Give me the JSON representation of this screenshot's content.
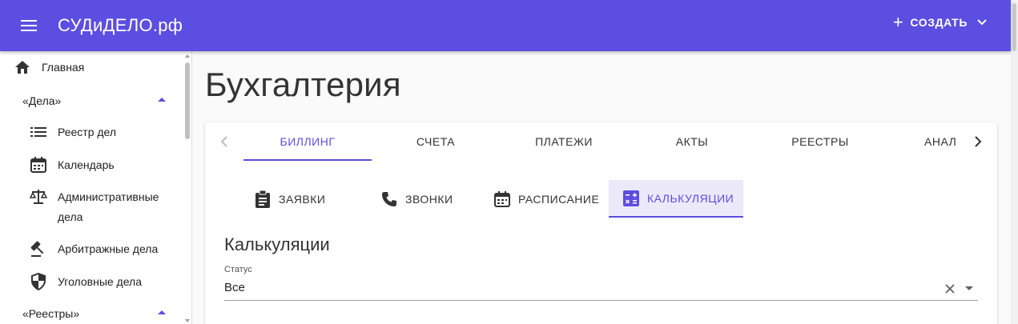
{
  "appbar": {
    "brand": "СУДиДЕЛО.рф",
    "create_label": "СОЗДАТЬ",
    "bg_color": "#5c4ee0"
  },
  "sidebar": {
    "items": [
      {
        "label": "Главная",
        "icon": "home-icon"
      },
      {
        "group": "«Дела»"
      },
      {
        "label": "Реестр дел",
        "icon": "list-icon"
      },
      {
        "label": "Календарь",
        "icon": "calendar-icon"
      },
      {
        "label": "Административные дела",
        "label_line1": "Административные",
        "label_line2": "дела",
        "icon": "scales-icon"
      },
      {
        "label": "Арбитражные дела",
        "icon": "gavel-icon"
      },
      {
        "label": "Уголовные дела",
        "icon": "shield-icon"
      },
      {
        "group": "«Реестры»"
      }
    ]
  },
  "page": {
    "title": "Бухгалтерия"
  },
  "tabs": [
    {
      "label": "БИЛЛИНГ",
      "active": true
    },
    {
      "label": "СЧЕТА"
    },
    {
      "label": "ПЛАТЕЖИ"
    },
    {
      "label": "АКТЫ"
    },
    {
      "label": "РЕЕСТРЫ"
    },
    {
      "label": "АНАЛ"
    }
  ],
  "subtabs": [
    {
      "label": "ЗАЯВКИ",
      "icon": "clipboard-icon"
    },
    {
      "label": "ЗВОНКИ",
      "icon": "phone-icon"
    },
    {
      "label": "РАСПИСАНИЕ",
      "icon": "calendar-icon"
    },
    {
      "label": "КАЛЬКУЛЯЦИИ",
      "icon": "calculator-icon",
      "active": true
    }
  ],
  "section": {
    "title": "Калькуляции",
    "status_label": "Статус",
    "status_value": "Все"
  },
  "accent_color": "#5c4ee0"
}
